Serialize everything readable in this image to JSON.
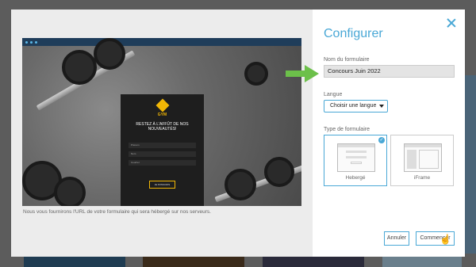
{
  "modal": {
    "title": "Configurer",
    "caption": "Nous vous fournirons l'URL de votre formulaire qui sera hébergé sur nos serveurs.",
    "fields": {
      "name_label": "Nom du formulaire",
      "name_value": "Concours Juin 2022",
      "language_label": "Langue",
      "language_value": "Choisir une langue",
      "type_label": "Type de formulaire"
    },
    "types": [
      {
        "label": "Hebergé",
        "selected": true
      },
      {
        "label": "iFrame",
        "selected": false
      }
    ],
    "buttons": {
      "cancel": "Annuler",
      "start": "Commencer"
    }
  },
  "preview_form": {
    "brand": "GYM",
    "headline": "RESTEZ À L'AFFÛT DE NOS NOUVEAUTÉS!",
    "fields": [
      "Prénom",
      "Nom",
      "Courriel"
    ],
    "button": "JE M'INSCRIS"
  },
  "colors": {
    "accent": "#4aa8d6",
    "arrow": "#6cc04a",
    "gym_yellow": "#f2b705"
  }
}
